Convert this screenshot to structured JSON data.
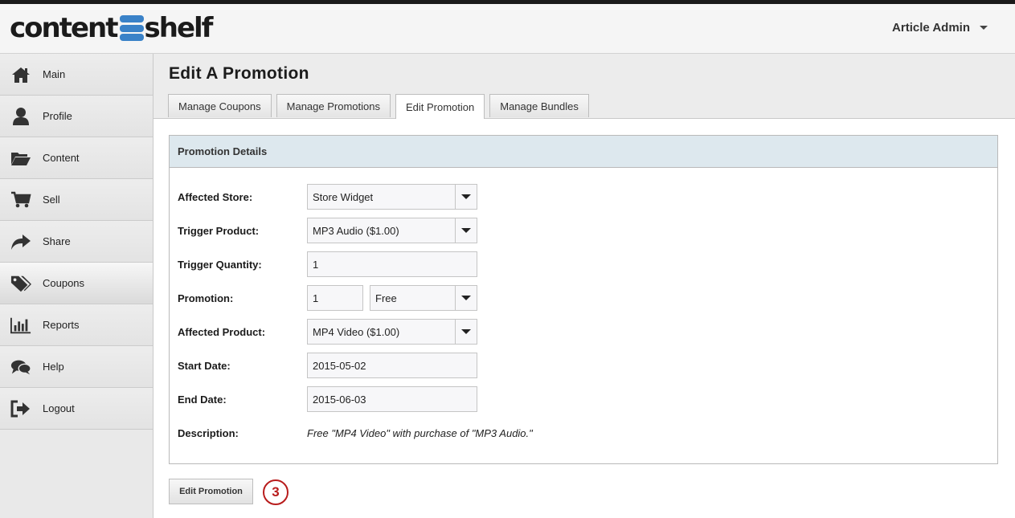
{
  "header": {
    "logo_left": "content",
    "logo_right": "shelf",
    "user_label": "Article Admin"
  },
  "sidebar": {
    "items": [
      {
        "label": "Main",
        "icon": "home-icon"
      },
      {
        "label": "Profile",
        "icon": "user-icon"
      },
      {
        "label": "Content",
        "icon": "folder-open-icon"
      },
      {
        "label": "Sell",
        "icon": "cart-icon"
      },
      {
        "label": "Share",
        "icon": "share-arrow-icon"
      },
      {
        "label": "Coupons",
        "icon": "tags-icon",
        "active": true
      },
      {
        "label": "Reports",
        "icon": "bar-chart-icon"
      },
      {
        "label": "Help",
        "icon": "chat-bubbles-icon"
      },
      {
        "label": "Logout",
        "icon": "sign-out-icon"
      }
    ]
  },
  "main": {
    "title": "Edit A Promotion",
    "tabs": [
      {
        "label": "Manage Coupons"
      },
      {
        "label": "Manage Promotions"
      },
      {
        "label": "Edit Promotion",
        "active": true
      },
      {
        "label": "Manage Bundles"
      }
    ],
    "panel": {
      "title": "Promotion Details",
      "affected_store": {
        "label": "Affected Store:",
        "value": "Store Widget"
      },
      "trigger_product": {
        "label": "Trigger Product:",
        "value": "MP3 Audio ($1.00)"
      },
      "trigger_quantity": {
        "label": "Trigger Quantity:",
        "value": "1"
      },
      "promotion": {
        "label": "Promotion:",
        "amount": "1",
        "type": "Free"
      },
      "affected_product": {
        "label": "Affected Product:",
        "value": "MP4 Video ($1.00)"
      },
      "start_date": {
        "label": "Start Date:",
        "value": "2015-05-02"
      },
      "end_date": {
        "label": "End Date:",
        "value": "2015-06-03"
      },
      "description": {
        "label": "Description:",
        "value": "Free \"MP4 Video\" with purchase of \"MP3 Audio.\""
      }
    },
    "submit_label": "Edit Promotion",
    "step_badge": "3"
  },
  "colors": {
    "accent_blue": "#3a82c8",
    "panel_header": "#dde8ee",
    "badge_red": "#b81c1c"
  }
}
